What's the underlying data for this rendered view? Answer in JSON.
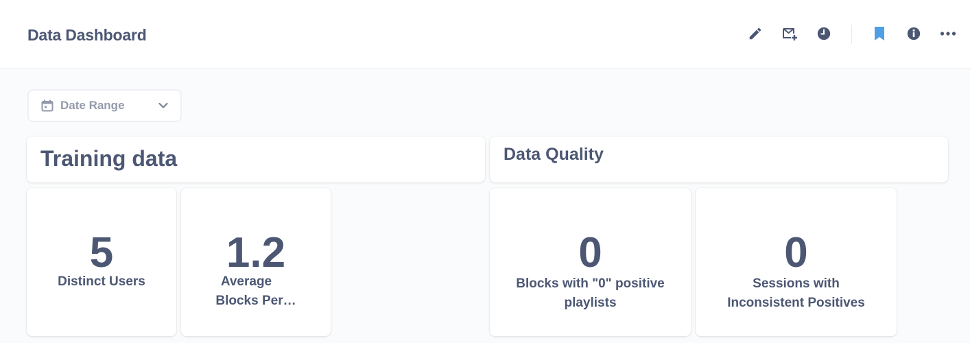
{
  "header": {
    "title": "Data Dashboard",
    "icons": [
      "pencil-icon",
      "subscription-icon",
      "clock-icon",
      "bookmark-icon",
      "info-icon",
      "more-icon"
    ],
    "bookmark_color": "#509ee3"
  },
  "filters": {
    "date_range_label": "Date Range"
  },
  "sections": {
    "training_heading": "Training data",
    "quality_heading": "Data Quality"
  },
  "metrics": {
    "distinct_users": {
      "value": "5",
      "label": "Distinct Users"
    },
    "avg_blocks": {
      "value": "1.2",
      "label_line1": "Average",
      "label_line2": "Blocks Per…"
    },
    "zero_blocks": {
      "value": "0",
      "label_line1": "Blocks with \"0\" positive",
      "label_line2": "playlists"
    },
    "inconsistent_sessions": {
      "value": "0",
      "label_line1": "Sessions with",
      "label_line2": "Inconsistent Positives"
    }
  },
  "colors": {
    "text": "#4c5773",
    "muted": "#949aab",
    "background": "#f9fbfc"
  }
}
